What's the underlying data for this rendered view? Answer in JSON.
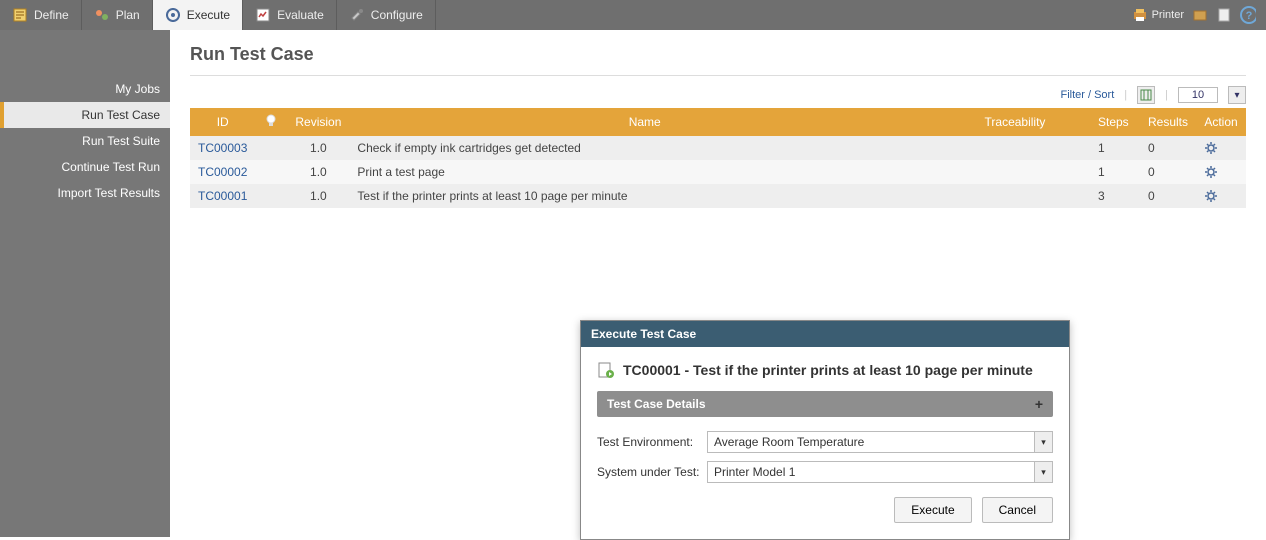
{
  "topbar": {
    "items": [
      {
        "label": "Define"
      },
      {
        "label": "Plan"
      },
      {
        "label": "Execute"
      },
      {
        "label": "Evaluate"
      },
      {
        "label": "Configure"
      }
    ],
    "printer_label": "Printer"
  },
  "sidebar": {
    "items": [
      {
        "label": "My Jobs"
      },
      {
        "label": "Run Test Case"
      },
      {
        "label": "Run Test Suite"
      },
      {
        "label": "Continue Test Run"
      },
      {
        "label": "Import Test Results"
      }
    ]
  },
  "page": {
    "title": "Run Test Case",
    "filter_sort": "Filter / Sort",
    "page_size": "10"
  },
  "table": {
    "headers": {
      "id": "ID",
      "bulb": "",
      "revision": "Revision",
      "name": "Name",
      "traceability": "Traceability",
      "steps": "Steps",
      "results": "Results",
      "action": "Action"
    },
    "rows": [
      {
        "id": "TC00003",
        "revision": "1.0",
        "name": "Check if empty ink cartridges get detected",
        "traceability": "",
        "steps": "1",
        "results": "0"
      },
      {
        "id": "TC00002",
        "revision": "1.0",
        "name": "Print a test page",
        "traceability": "",
        "steps": "1",
        "results": "0"
      },
      {
        "id": "TC00001",
        "revision": "1.0",
        "name": "Test if the printer prints at least 10 page per minute",
        "traceability": "",
        "steps": "3",
        "results": "0"
      }
    ]
  },
  "modal": {
    "header": "Execute Test Case",
    "title": "TC00001 - Test if the printer prints at least 10 page per minute",
    "section": "Test Case Details",
    "test_env_label": "Test Environment:",
    "test_env_value": "Average Room Temperature",
    "sut_label": "System under Test:",
    "sut_value": "Printer Model 1",
    "execute": "Execute",
    "cancel": "Cancel"
  }
}
